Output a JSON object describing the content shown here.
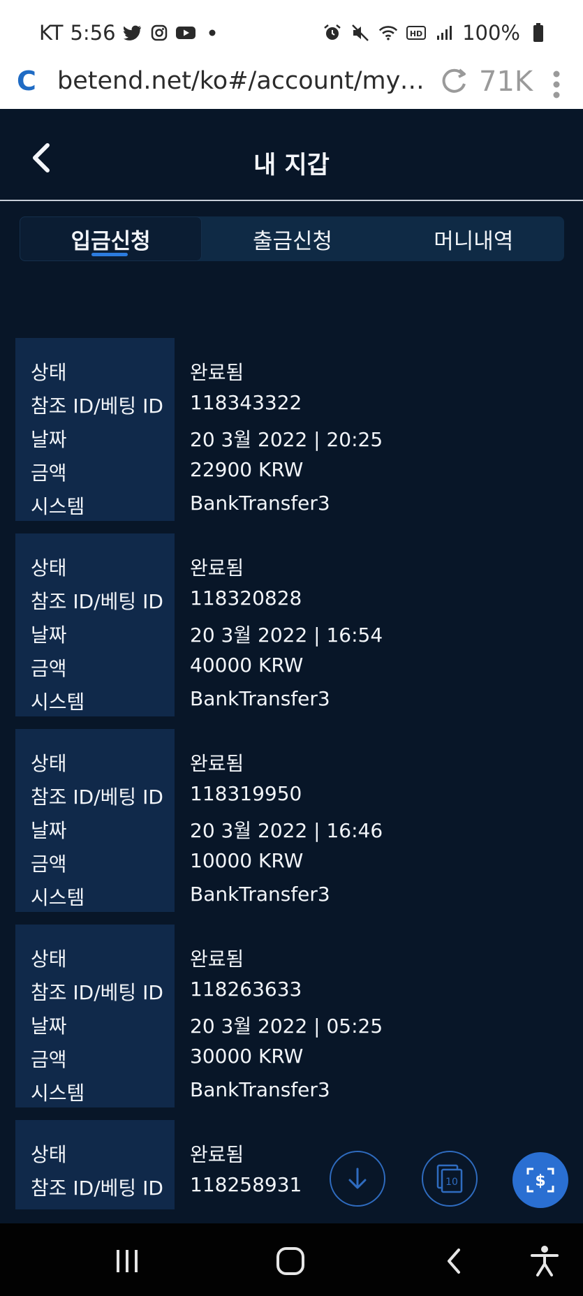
{
  "status_bar": {
    "carrier": "KT",
    "time": "5:56",
    "battery": "100%",
    "left_icons": [
      "twitter-icon",
      "instagram-icon",
      "youtube-icon",
      "dot-icon"
    ],
    "right_icons": [
      "alarm-icon",
      "mute-icon",
      "wifi-icon",
      "hd-icon",
      "signal-icon",
      "battery-icon"
    ]
  },
  "browser": {
    "logo": "C",
    "url": "betend.net/ko#/account/my-w...",
    "tab_count": "71K"
  },
  "header": {
    "title": "내 지갑"
  },
  "tabs": [
    {
      "label": "입금신청",
      "active": true
    },
    {
      "label": "출금신청",
      "active": false
    },
    {
      "label": "머니내역",
      "active": false
    }
  ],
  "labels": {
    "status": "상태",
    "ref_id": "참조 ID/베팅 ID",
    "date": "날짜",
    "amount": "금액",
    "system": "시스템"
  },
  "records": [
    {
      "status": "완료됨",
      "ref_id": "118343322",
      "date": "20 3월 2022 | 20:25",
      "amount": "22900 KRW",
      "system": "BankTransfer3"
    },
    {
      "status": "완료됨",
      "ref_id": "118320828",
      "date": "20 3월 2022 | 16:54",
      "amount": "40000 KRW",
      "system": "BankTransfer3"
    },
    {
      "status": "완료됨",
      "ref_id": "118319950",
      "date": "20 3월 2022 | 16:46",
      "amount": "10000 KRW",
      "system": "BankTransfer3"
    },
    {
      "status": "완료됨",
      "ref_id": "118263633",
      "date": "20 3월 2022 | 05:25",
      "amount": "30000 KRW",
      "system": "BankTransfer3"
    },
    {
      "status": "완료됨",
      "ref_id": "118258931"
    }
  ],
  "fab": {
    "bets_count": "10"
  },
  "colors": {
    "background": "#081628",
    "panel": "#10294a",
    "accent": "#2a6fd2"
  }
}
